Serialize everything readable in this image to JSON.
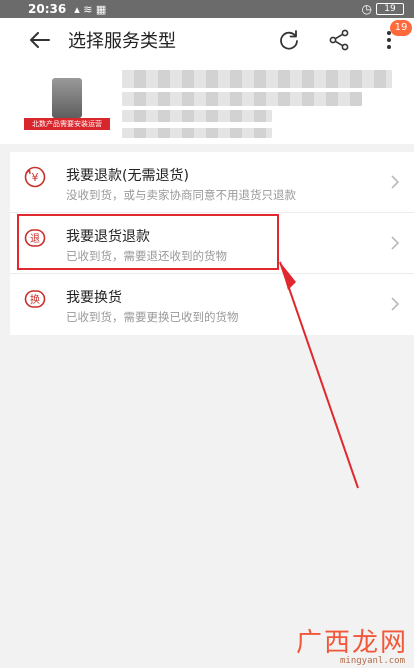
{
  "status_bar": {
    "time": "20:36",
    "battery": "19"
  },
  "app_bar": {
    "title": "选择服务类型",
    "badge_count": "19"
  },
  "product": {
    "shop_label": "北数产品需要安装运营"
  },
  "options": [
    {
      "label": "我要退款(无需退货)",
      "desc": "没收到货，或与卖家协商同意不用退货只退款",
      "icon_char": "¥"
    },
    {
      "label": "我要退货退款",
      "desc": "已收到货，需要退还收到的货物",
      "icon_char": "退"
    },
    {
      "label": "我要换货",
      "desc": "已收到货，需要更换已收到的货物",
      "icon_char": "换"
    }
  ],
  "watermark": {
    "brand": "广西龙网",
    "url": "mingyanl.com"
  },
  "colors": {
    "accent": "#e0282e",
    "badge": "#ff6a3d",
    "icon_red": "#c9302c"
  }
}
